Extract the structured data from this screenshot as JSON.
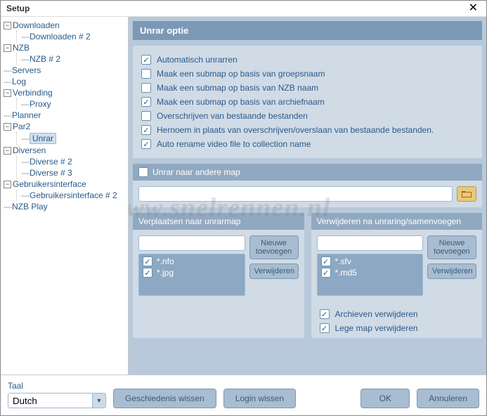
{
  "window": {
    "title": "Setup",
    "close_icon": "✕"
  },
  "watermark": "www.snelrennen.nl",
  "tree": [
    {
      "label": "Downloaden",
      "expanded": true,
      "children": [
        {
          "label": "Downloaden # 2"
        }
      ]
    },
    {
      "label": "NZB",
      "expanded": true,
      "children": [
        {
          "label": "NZB # 2"
        }
      ]
    },
    {
      "label": "Servers"
    },
    {
      "label": "Log"
    },
    {
      "label": "Verbinding",
      "expanded": true,
      "children": [
        {
          "label": "Proxy"
        }
      ]
    },
    {
      "label": "Planner"
    },
    {
      "label": "Par2",
      "expanded": true,
      "children": [
        {
          "label": "Unrar",
          "selected": true
        }
      ]
    },
    {
      "label": "Diversen",
      "expanded": true,
      "children": [
        {
          "label": "Diverse # 2"
        },
        {
          "label": "Diverse # 3"
        }
      ]
    },
    {
      "label": "Gebruikersinterface",
      "expanded": true,
      "children": [
        {
          "label": "Gebruikersinterface # 2"
        }
      ]
    },
    {
      "label": "NZB Play"
    }
  ],
  "panel": {
    "title": "Unrar optie",
    "options": [
      {
        "label": "Automatisch unrarren",
        "checked": true
      },
      {
        "label": "Maak een submap op basis van groepsnaam",
        "checked": false
      },
      {
        "label": "Maak een submap op basis van NZB naam",
        "checked": false
      },
      {
        "label": "Maak een submap op basis van archiefnaam",
        "checked": true
      },
      {
        "label": "Overschrijven van bestaande bestanden",
        "checked": false
      },
      {
        "label": "Hernoem in plaats van overschrijven/overslaan van bestaande bestanden.",
        "checked": true
      },
      {
        "label": "Auto rename video file to collection name",
        "checked": true
      }
    ],
    "other_folder": {
      "label": "Unrar naar andere map",
      "checked": false,
      "path": ""
    },
    "move": {
      "title": "Verplaatsen naar unrarmap",
      "add_btn": "Nieuwe toevoegen",
      "del_btn": "Verwijderen",
      "input": "",
      "items": [
        {
          "label": "*.nfo",
          "checked": true
        },
        {
          "label": "*.jpg",
          "checked": true
        }
      ]
    },
    "remove": {
      "title": "Verwijderen na unraring/samenvoegen",
      "add_btn": "Nieuwe toevoegen",
      "del_btn": "Verwijderen",
      "input": "",
      "items": [
        {
          "label": "*.sfv",
          "checked": true
        },
        {
          "label": "*.md5",
          "checked": true
        }
      ]
    },
    "post": [
      {
        "label": "Archieven verwijderen",
        "checked": true
      },
      {
        "label": "Lege map verwijderen",
        "checked": true
      }
    ]
  },
  "footer": {
    "lang_label": "Taal",
    "language": "Dutch",
    "history_btn": "Geschiedenis wissen",
    "login_btn": "Login wissen",
    "ok_btn": "OK",
    "cancel_btn": "Annuleren"
  }
}
